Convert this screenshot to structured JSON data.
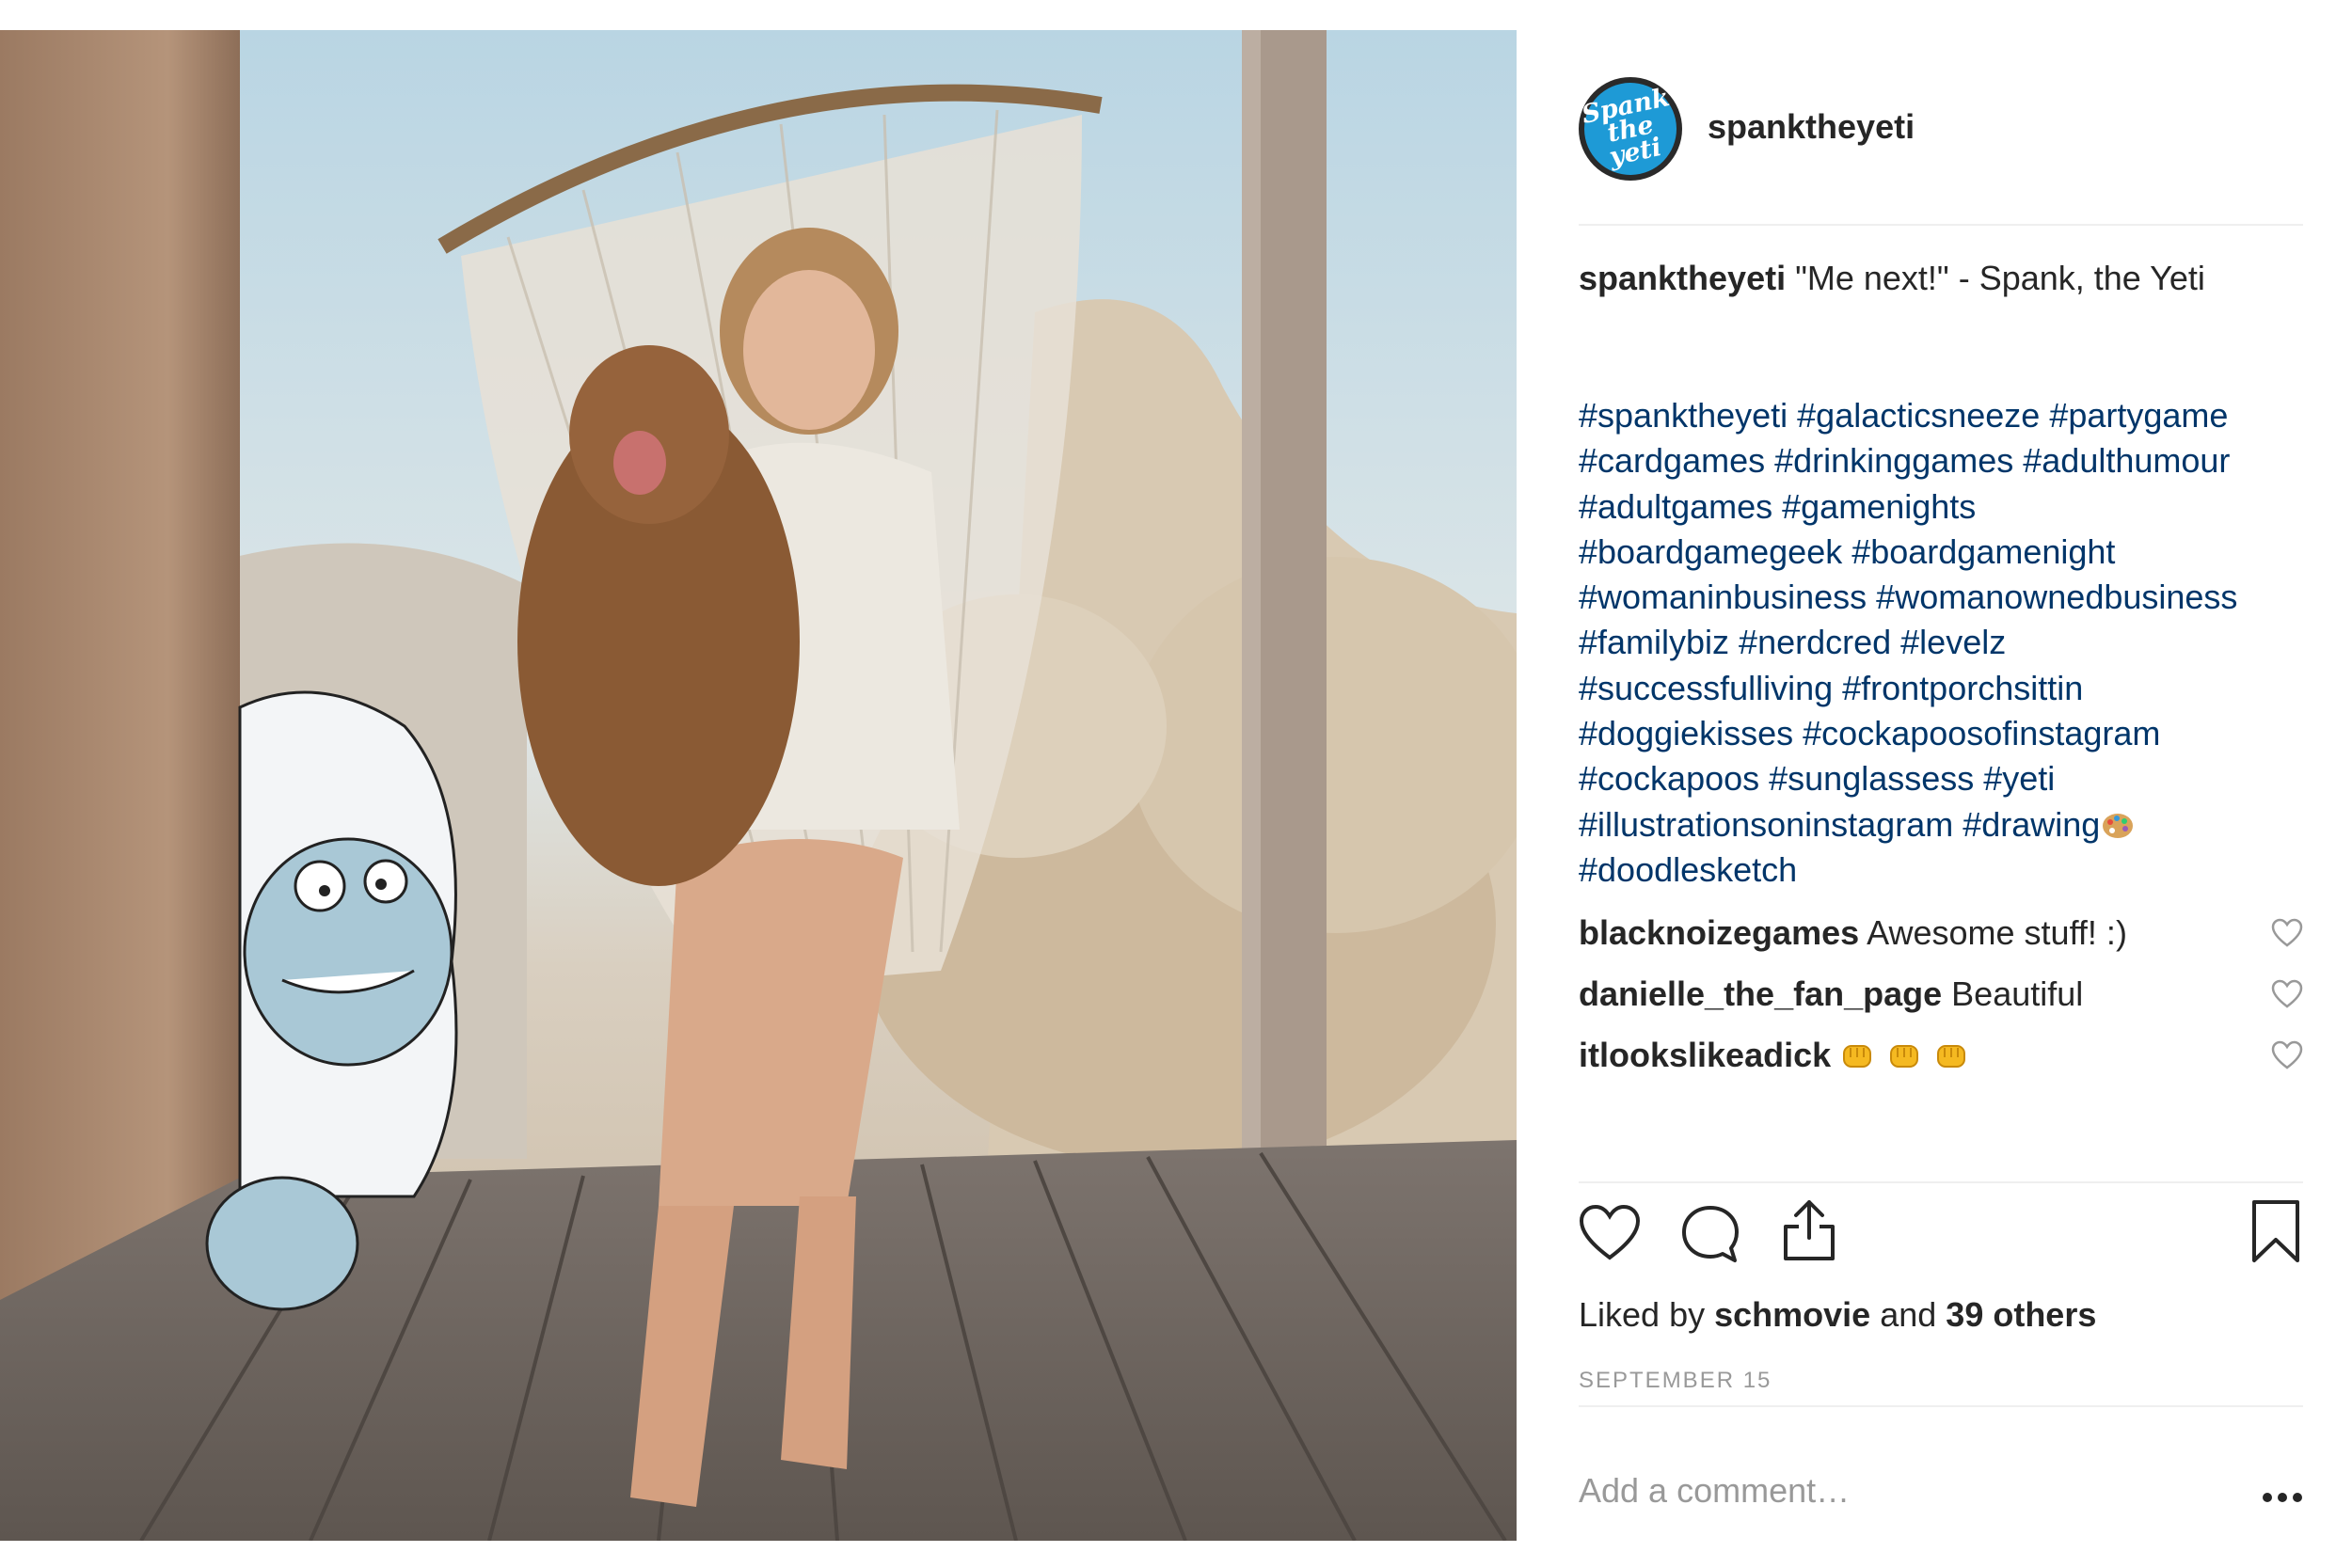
{
  "post": {
    "username": "spanktheyeti",
    "avatar_text": "Spank the yeti",
    "caption_text": "\"Me next!\" - Spank, the Yeti",
    "hashtag_lines": [
      "#spanktheyeti #galacticsneeze #partygame",
      "#cardgames #drinkinggames #adulthumour",
      "#adultgames #gamenights",
      "#boardgamegeek #boardgamenight",
      "#womaninbusiness #womanownedbusiness",
      "#familybiz #nerdcred #levelz",
      "#successfulliving #frontporchsittin",
      "#doggiekisses #cockapoosofinstagram",
      "#cockapoos #sunglassess #yeti",
      "#illustrationsoninstagram #drawing",
      "#doodlesketch"
    ],
    "comments": [
      {
        "user": "blacknoizegames",
        "text": "Awesome stuff! :)"
      },
      {
        "user": "danielle_the_fan_page",
        "text": "Beautiful"
      },
      {
        "user": "itlookslikeadick",
        "text": ""
      }
    ],
    "likes": {
      "prefix": "Liked by",
      "user": "schmovie",
      "joiner": "and",
      "others": "39 others"
    },
    "date": "SEPTEMBER 15",
    "comment_placeholder": "Add a comment…",
    "icons": [
      "heart-icon",
      "comment-icon",
      "share-icon",
      "bookmark-icon",
      "more-icon"
    ],
    "colors": {
      "hashtag": "#003569",
      "text": "#262626",
      "muted": "#999999",
      "avatar_bg": "#1e9ad6"
    }
  }
}
